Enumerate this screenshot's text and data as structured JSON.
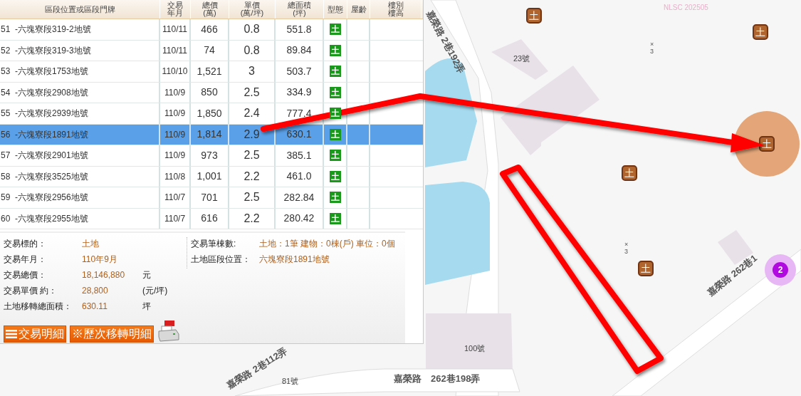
{
  "table": {
    "columns": [
      {
        "lines": [
          "區段位置或區段門牌"
        ]
      },
      {
        "lines": [
          "交易",
          "年月"
        ]
      },
      {
        "lines": [
          "總價",
          "(萬)"
        ]
      },
      {
        "lines": [
          "單價",
          "(萬/坪)"
        ]
      },
      {
        "lines": [
          "總面積",
          "(坪)"
        ]
      },
      {
        "lines": [
          "型態"
        ]
      },
      {
        "lines": [
          "屋齡"
        ]
      },
      {
        "lines": [
          "樓別",
          "樓高"
        ]
      }
    ],
    "rows": [
      {
        "location": "51  -六塊寮段319-2地號",
        "date": "110/11",
        "total": "466",
        "unit_price": "0.8",
        "area": "551.8",
        "type": "土",
        "selected": false
      },
      {
        "location": "52  -六塊寮段319-3地號",
        "date": "110/11",
        "total": "74",
        "unit_price": "0.8",
        "area": "89.84",
        "type": "土",
        "selected": false
      },
      {
        "location": "53  -六塊寮段1753地號",
        "date": "110/10",
        "total": "1,521",
        "unit_price": "3",
        "area": "503.7",
        "type": "土",
        "selected": false
      },
      {
        "location": "54  -六塊寮段2908地號",
        "date": "110/9",
        "total": "850",
        "unit_price": "2.5",
        "area": "334.9",
        "type": "土",
        "selected": false
      },
      {
        "location": "55  -六塊寮段2939地號",
        "date": "110/9",
        "total": "1,850",
        "unit_price": "2.4",
        "area": "777.4",
        "type": "土",
        "selected": false
      },
      {
        "location": "56  -六塊寮段1891地號",
        "date": "110/9",
        "total": "1,814",
        "unit_price": "2.9",
        "area": "630.1",
        "type": "土",
        "selected": true
      },
      {
        "location": "57  -六塊寮段2901地號",
        "date": "110/9",
        "total": "973",
        "unit_price": "2.5",
        "area": "385.1",
        "type": "土",
        "selected": false
      },
      {
        "location": "58  -六塊寮段3525地號",
        "date": "110/8",
        "total": "1,001",
        "unit_price": "2.2",
        "area": "461.0",
        "type": "土",
        "selected": false
      },
      {
        "location": "59  -六塊寮段2956地號",
        "date": "110/7",
        "total": "701",
        "unit_price": "2.5",
        "area": "282.84",
        "type": "土",
        "selected": false
      },
      {
        "location": "60  -六塊寮段2955地號",
        "date": "110/7",
        "total": "616",
        "unit_price": "2.2",
        "area": "280.42",
        "type": "土",
        "selected": false
      }
    ]
  },
  "details": {
    "left": [
      {
        "label": "交易標的：",
        "value": "土地"
      },
      {
        "label": "交易年月：",
        "value": "110年9月"
      },
      {
        "label": "交易總價：",
        "value": "18,146,880",
        "unit": "元"
      },
      {
        "label": "交易單價 約：",
        "value": "28,800",
        "unit": "(元/坪)"
      },
      {
        "label": "土地移轉總面積：",
        "value": "630.11",
        "unit": "坪"
      }
    ],
    "right": [
      {
        "label": "交易筆棟數:",
        "value": "土地：1筆 建物：0棟(戶) 車位：0個"
      },
      {
        "label": "土地區段位置：",
        "value": "六塊寮段1891地號"
      }
    ]
  },
  "buttons": [
    {
      "kind": "list",
      "label": "交易明細"
    },
    {
      "kind": "plain",
      "label": "※歷次移轉明細"
    }
  ],
  "map": {
    "attribution": "NLSC 202505",
    "labels": [
      {
        "kind": "road",
        "text": "嘉榮路 2巷192弄"
      },
      {
        "kind": "number",
        "text": "23號"
      },
      {
        "kind": "mark",
        "text": "×3"
      },
      {
        "kind": "mark",
        "text": "×3"
      },
      {
        "kind": "road",
        "text": "嘉榮路 262巷1"
      },
      {
        "kind": "number",
        "text": "100號"
      },
      {
        "kind": "road",
        "text": "嘉榮路 2巷112弄"
      },
      {
        "kind": "number",
        "text": "81號"
      },
      {
        "kind": "road",
        "text": "嘉榮路　262巷198弄"
      }
    ],
    "markers": [
      {
        "label": "土",
        "highlighted": false
      },
      {
        "label": "土",
        "highlighted": false
      },
      {
        "label": "土",
        "highlighted": true
      },
      {
        "label": "土",
        "highlighted": false
      },
      {
        "label": "土",
        "highlighted": false
      }
    ],
    "cluster": {
      "count": "2"
    }
  }
}
